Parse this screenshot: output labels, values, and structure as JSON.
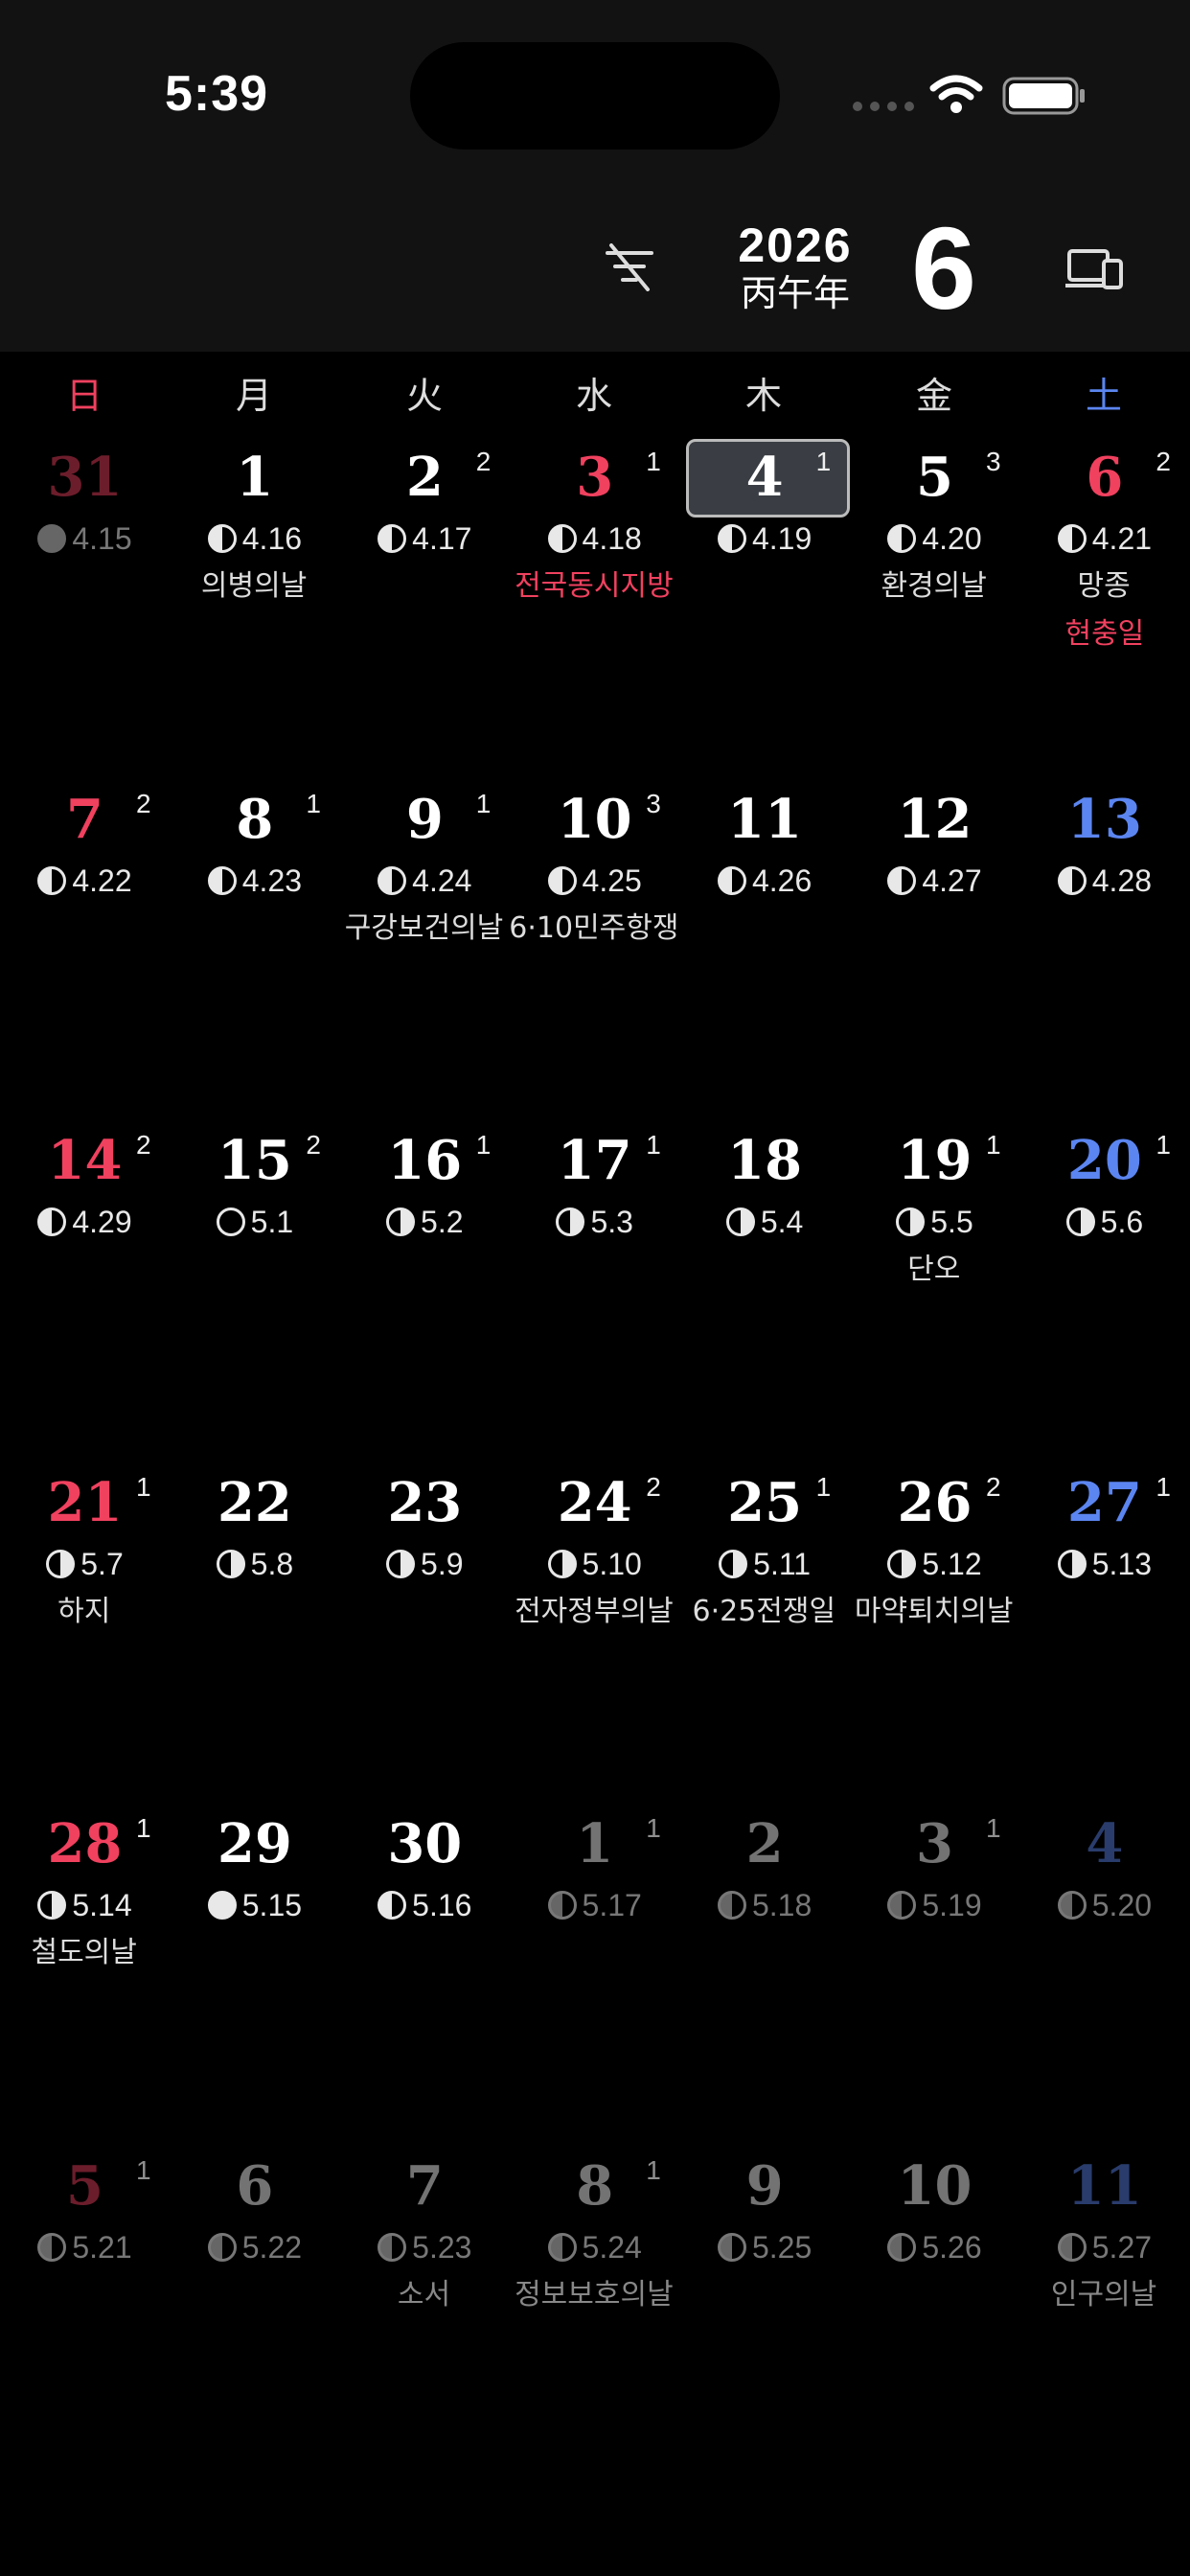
{
  "status_bar": {
    "time": "5:39"
  },
  "header": {
    "year": "2026",
    "ganzhi": "丙午年",
    "month": "6"
  },
  "weekdays": [
    "日",
    "月",
    "火",
    "水",
    "木",
    "金",
    "土"
  ],
  "colors": {
    "sunday": "#f0415f",
    "saturday": "#5b85f0",
    "weekday": "#ffffff",
    "holiday_red": "#f0415f",
    "dim": "#666666"
  },
  "weeks": [
    [
      {
        "day": "31",
        "lunar": "4.15",
        "phase": "dark",
        "dim": true,
        "color": "sun"
      },
      {
        "day": "1",
        "lunar": "4.16",
        "phase": "half",
        "note": "의병의날"
      },
      {
        "day": "2",
        "badge": "2",
        "lunar": "4.17",
        "phase": "half"
      },
      {
        "day": "3",
        "badge": "1",
        "lunar": "4.18",
        "phase": "half",
        "color": "sun",
        "note": "전국동시지방",
        "note_red": true
      },
      {
        "day": "4",
        "badge": "1",
        "lunar": "4.19",
        "phase": "half",
        "today": true
      },
      {
        "day": "5",
        "badge": "3",
        "lunar": "4.20",
        "phase": "half",
        "note": "환경의날"
      },
      {
        "day": "6",
        "badge": "2",
        "lunar": "4.21",
        "phase": "half",
        "color": "sun",
        "note": "망종",
        "note2": "현충일",
        "note2_red": true
      }
    ],
    [
      {
        "day": "7",
        "badge": "2",
        "lunar": "4.22",
        "phase": "half",
        "color": "sun"
      },
      {
        "day": "8",
        "badge": "1",
        "lunar": "4.23",
        "phase": "half"
      },
      {
        "day": "9",
        "badge": "1",
        "lunar": "4.24",
        "phase": "half",
        "note": "구강보건의날"
      },
      {
        "day": "10",
        "badge": "3",
        "lunar": "4.25",
        "phase": "half",
        "note": "6·10민주항쟁"
      },
      {
        "day": "11",
        "lunar": "4.26",
        "phase": "half"
      },
      {
        "day": "12",
        "lunar": "4.27",
        "phase": "half"
      },
      {
        "day": "13",
        "lunar": "4.28",
        "phase": "half",
        "color": "sat"
      }
    ],
    [
      {
        "day": "14",
        "badge": "2",
        "lunar": "4.29",
        "phase": "half",
        "color": "sun"
      },
      {
        "day": "15",
        "badge": "2",
        "lunar": "5.1",
        "phase": "new"
      },
      {
        "day": "16",
        "badge": "1",
        "lunar": "5.2",
        "phase": "wax"
      },
      {
        "day": "17",
        "badge": "1",
        "lunar": "5.3",
        "phase": "wax"
      },
      {
        "day": "18",
        "lunar": "5.4",
        "phase": "wax"
      },
      {
        "day": "19",
        "badge": "1",
        "lunar": "5.5",
        "phase": "wax",
        "note": "단오"
      },
      {
        "day": "20",
        "badge": "1",
        "lunar": "5.6",
        "phase": "wax",
        "color": "sat"
      }
    ],
    [
      {
        "day": "21",
        "badge": "1",
        "lunar": "5.7",
        "phase": "wax",
        "color": "sun",
        "note": "하지"
      },
      {
        "day": "22",
        "lunar": "5.8",
        "phase": "wax"
      },
      {
        "day": "23",
        "lunar": "5.9",
        "phase": "wax"
      },
      {
        "day": "24",
        "badge": "2",
        "lunar": "5.10",
        "phase": "wax",
        "note": "전자정부의날"
      },
      {
        "day": "25",
        "badge": "1",
        "lunar": "5.11",
        "phase": "wax",
        "note": "6·25전쟁일"
      },
      {
        "day": "26",
        "badge": "2",
        "lunar": "5.12",
        "phase": "wax",
        "note": "마약퇴치의날"
      },
      {
        "day": "27",
        "badge": "1",
        "lunar": "5.13",
        "phase": "wax",
        "color": "sat"
      }
    ],
    [
      {
        "day": "28",
        "badge": "1",
        "lunar": "5.14",
        "phase": "wax",
        "color": "sun",
        "note": "철도의날"
      },
      {
        "day": "29",
        "lunar": "5.15",
        "phase": "full"
      },
      {
        "day": "30",
        "lunar": "5.16",
        "phase": "half"
      },
      {
        "day": "1",
        "badge": "1",
        "lunar": "5.17",
        "phase": "half",
        "dim": true
      },
      {
        "day": "2",
        "lunar": "5.18",
        "phase": "half",
        "dim": true
      },
      {
        "day": "3",
        "badge": "1",
        "lunar": "5.19",
        "phase": "half",
        "dim": true
      },
      {
        "day": "4",
        "lunar": "5.20",
        "phase": "half",
        "dim": true,
        "color": "sat"
      }
    ],
    [
      {
        "day": "5",
        "badge": "1",
        "lunar": "5.21",
        "phase": "half",
        "dim": true,
        "color": "sun"
      },
      {
        "day": "6",
        "lunar": "5.22",
        "phase": "half",
        "dim": true
      },
      {
        "day": "7",
        "lunar": "5.23",
        "phase": "half",
        "dim": true,
        "note": "소서"
      },
      {
        "day": "8",
        "badge": "1",
        "lunar": "5.24",
        "phase": "half",
        "dim": true,
        "note": "정보보호의날"
      },
      {
        "day": "9",
        "lunar": "5.25",
        "phase": "half",
        "dim": true
      },
      {
        "day": "10",
        "lunar": "5.26",
        "phase": "half",
        "dim": true
      },
      {
        "day": "11",
        "lunar": "5.27",
        "phase": "half",
        "dim": true,
        "color": "sat",
        "note": "인구의날"
      }
    ]
  ]
}
